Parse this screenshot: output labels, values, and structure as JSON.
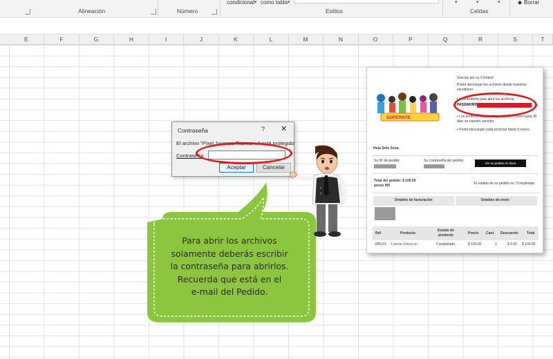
{
  "ribbon": {
    "groups": {
      "alineacion": "Alineación",
      "numero": "Número",
      "estilos": "Estilos",
      "celdas": "Celdas"
    },
    "format_conditional": "condicional",
    "format_table": "como tabla",
    "borrar": "Borrar"
  },
  "columns": [
    "E",
    "F",
    "G",
    "H",
    "I",
    "J",
    "K",
    "L",
    "M",
    "N",
    "O",
    "P",
    "Q",
    "R",
    "S",
    "T"
  ],
  "dialog": {
    "title": "Contraseña",
    "help": "?",
    "close": "✕",
    "message": "El archivo \"Pixel Juvenes Titanes ...\" está protegido",
    "password_label": "Contraseña:",
    "password_value": "",
    "accept": "Aceptar",
    "cancel": "Cancelar"
  },
  "email": {
    "thanks": "Gracias por su Compra!",
    "download": "Podrá descargar los archivos desde nuestros servidores.",
    "password_info": "La contraseña para abrir los archivos.",
    "password_label": "PASSWORD:",
    "availability": "• Los archivos estarán disponibles en línea hasta 30 días en nuestro servidor.",
    "download_times": "• Podrá descargar cada archivos hasta 5 veces.",
    "logo_text": "SUPERATE",
    "greeting": "Hola Sirla Sosa,",
    "order_number_label": "Su Nº de pedido:",
    "order_password_label": "Su contraseña del pedido:",
    "online_button": "Ver su pedido en línea",
    "total": "Total del pedido: $ 100.00 pesos MX",
    "status": "El estado de su pedido es: Completado.",
    "billing_header": "Detalles de facturación",
    "shipping_header": "Detalles de envío",
    "table_headers": [
      "Ref.",
      "Producto",
      "Estado de producto",
      "Precio",
      "Cant.",
      "Descuento",
      "Total"
    ],
    "row": [
      "JRN-01",
      "Lotería Vetros en",
      "Completado",
      "$ 100.00",
      "1",
      "$ 0.00",
      "$ 100.00"
    ]
  },
  "bubble": {
    "lines": [
      "Para abrir los archivos",
      "solamente deberás escribir",
      "la contraseña para abrirlos.",
      "Recuerda que está en el",
      "e-mail del Pedido."
    ],
    "color": "#8cc63f"
  },
  "colors": {
    "highlight": "#d81e1e",
    "password_redacted": "#e0182a"
  }
}
